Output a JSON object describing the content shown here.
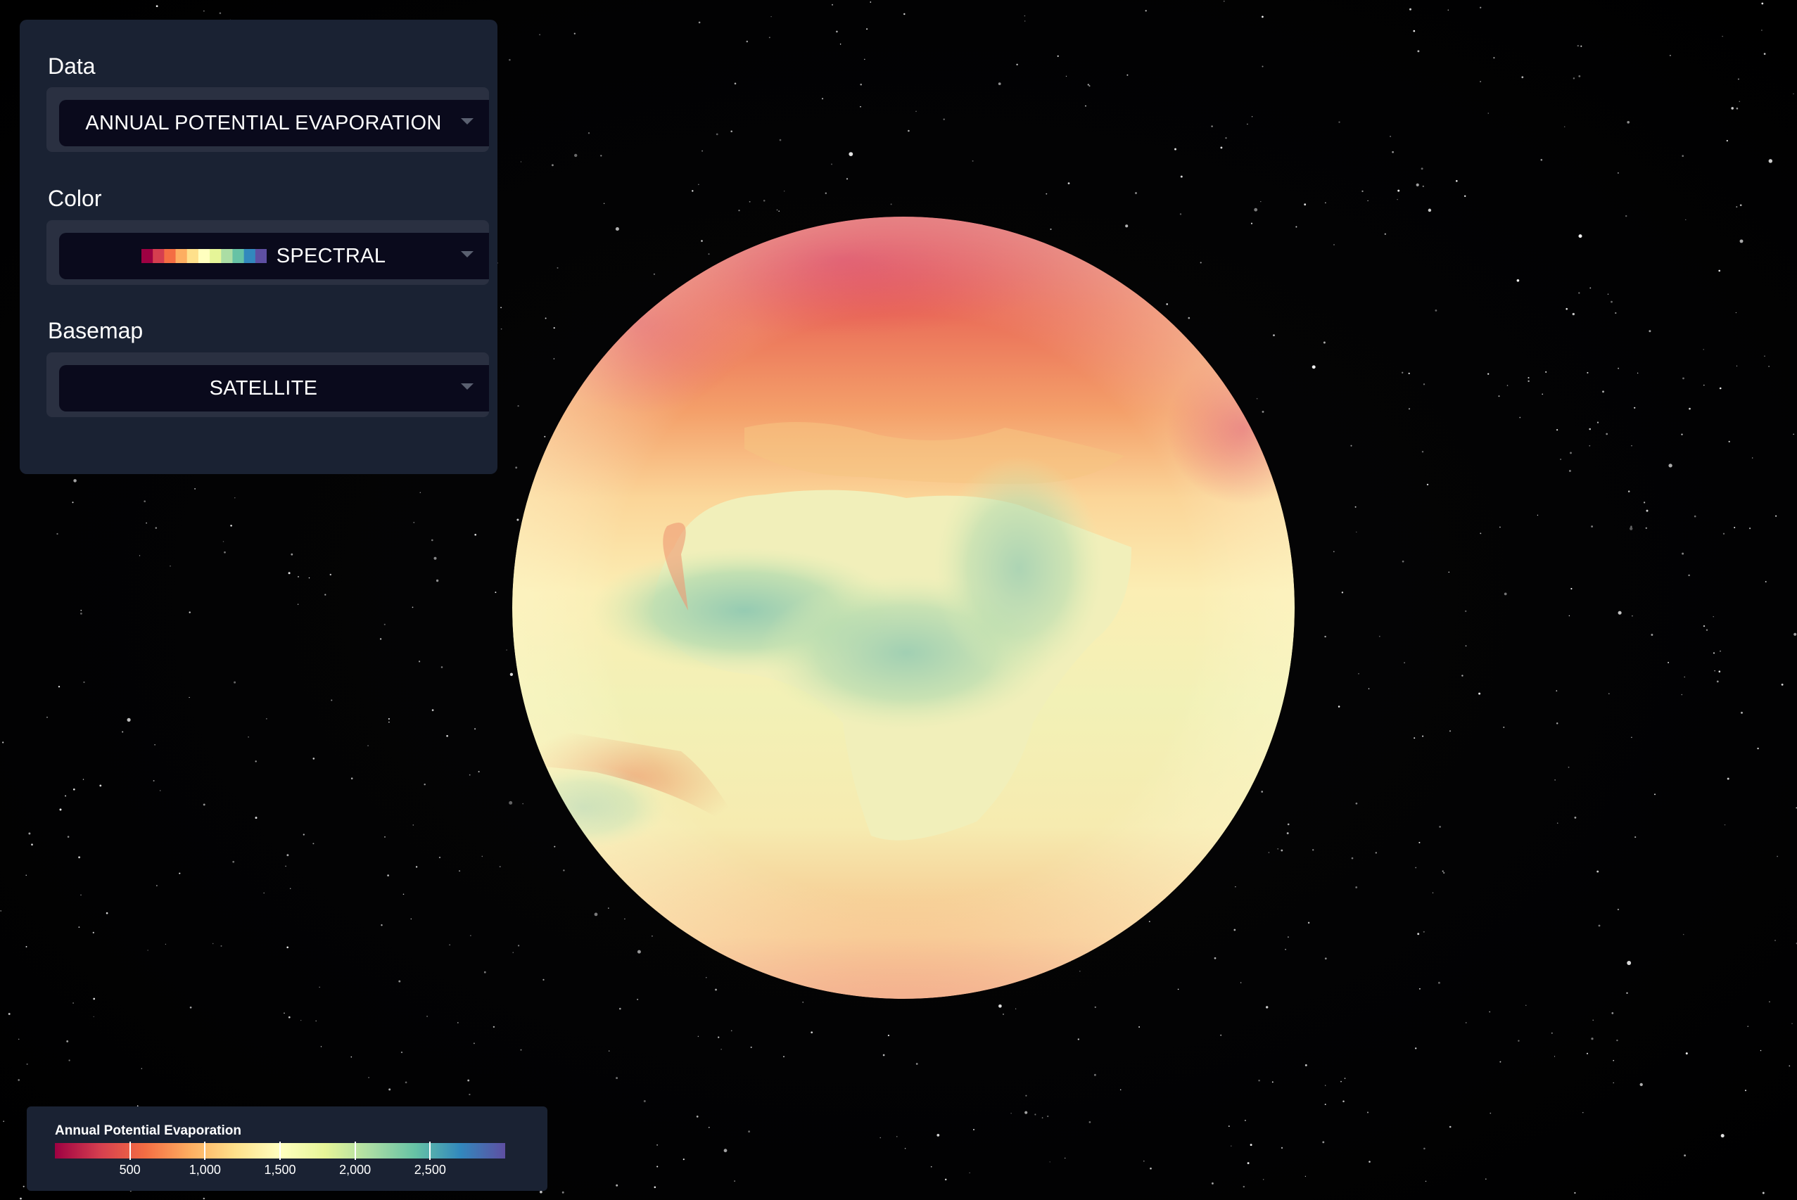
{
  "controls": {
    "data": {
      "label": "Data",
      "selected": "ANNUAL POTENTIAL EVAPORATION"
    },
    "color": {
      "label": "Color",
      "selected": "SPECTRAL",
      "ramp": [
        "#9e0142",
        "#d53e4f",
        "#f46d43",
        "#fdae61",
        "#fee08b",
        "#ffffbf",
        "#e6f598",
        "#abdda4",
        "#66c2a5",
        "#3288bd",
        "#5e4fa2"
      ]
    },
    "basemap": {
      "label": "Basemap",
      "selected": "SATELLITE"
    }
  },
  "legend": {
    "title": "Annual Potential Evaporation",
    "min": 0,
    "max": 3000,
    "ticks": [
      {
        "value": 500,
        "label": "500"
      },
      {
        "value": 1000,
        "label": "1,000"
      },
      {
        "value": 1500,
        "label": "1,500"
      },
      {
        "value": 2000,
        "label": "2,000"
      },
      {
        "value": 2500,
        "label": "2,500"
      }
    ]
  },
  "globe": {
    "icon": "earth-globe",
    "glow_color": "#fff8c8"
  }
}
